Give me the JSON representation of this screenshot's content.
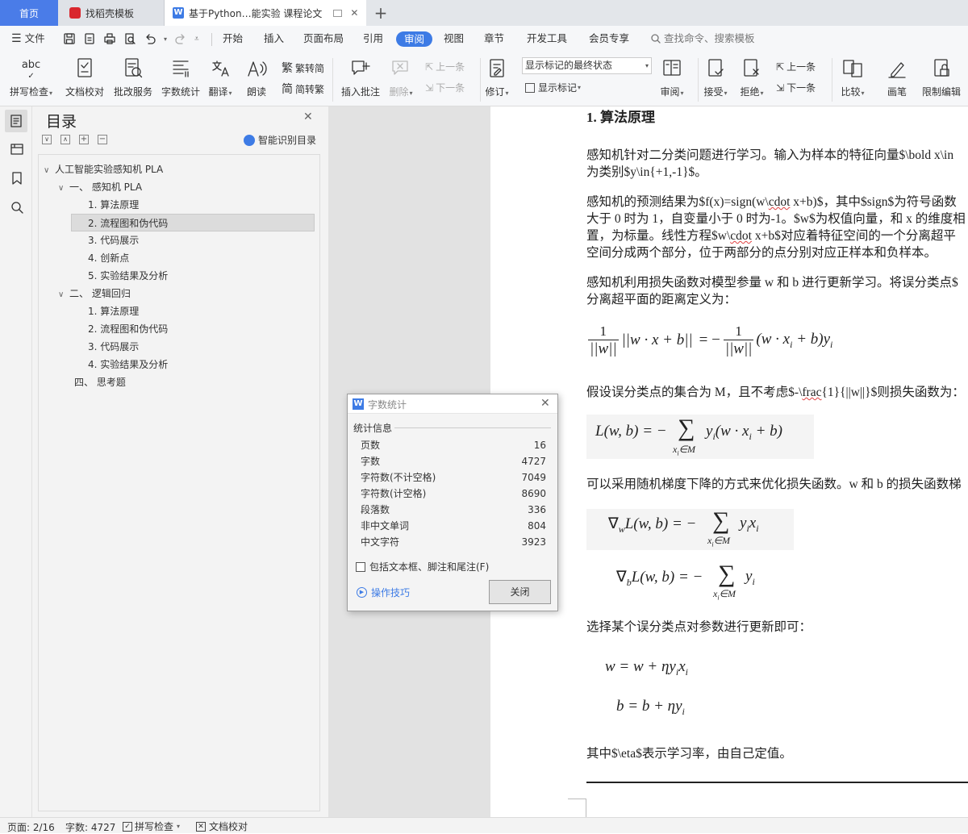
{
  "tabs": {
    "home": "首页",
    "template": "找稻壳模板",
    "doc": "基于Python…能实验 课程论文"
  },
  "menu": {
    "file": "文件",
    "items": [
      "开始",
      "插入",
      "页面布局",
      "引用",
      "审阅",
      "视图",
      "章节",
      "开发工具",
      "会员专享"
    ],
    "search": "查找命令、搜索模板"
  },
  "ribbon": {
    "spell": "拼写检查",
    "proof": "文档校对",
    "correct": "批改服务",
    "count": "字数统计",
    "translate": "翻译",
    "read": "朗读",
    "trad": "繁转简",
    "simp": "简转繁",
    "comment": "插入批注",
    "delete": "删除",
    "prev": "上一条",
    "next": "下一条",
    "revise": "修订",
    "markup_select": "显示标记的最终状态",
    "show_markup": "显示标记",
    "review": "审阅",
    "accept": "接受",
    "reject": "拒绝",
    "prev2": "上一条",
    "next2": "下一条",
    "compare": "比较",
    "pen": "画笔",
    "restrict": "限制编辑"
  },
  "toc": {
    "title": "目录",
    "smart": "智能识别目录",
    "items": [
      {
        "text": "人工智能实验感知机 PLA",
        "level": 0,
        "toggle": "∨"
      },
      {
        "text": "一、  感知机 PLA",
        "level": 1,
        "toggle": "∨"
      },
      {
        "text": "1. 算法原理",
        "level": 2
      },
      {
        "text": "2. 流程图和伪代码",
        "level": 2,
        "selected": true
      },
      {
        "text": "3. 代码展示",
        "level": 2
      },
      {
        "text": "4. 创新点",
        "level": 2
      },
      {
        "text": "5. 实验结果及分析",
        "level": 2
      },
      {
        "text": "二、  逻辑回归",
        "level": 1,
        "toggle": "∨"
      },
      {
        "text": "1. 算法原理",
        "level": 2
      },
      {
        "text": "2. 流程图和伪代码",
        "level": 2
      },
      {
        "text": "3. 代码展示",
        "level": 2
      },
      {
        "text": "4. 实验结果及分析",
        "level": 2
      },
      {
        "text": "四、  思考题",
        "level": 1
      }
    ]
  },
  "doc": {
    "heading": "1.  算法原理",
    "p1a": "感知机针对二分类问题进行学习。输入为样本的特征向量$\\bold x\\in",
    "p1b": "为类别$y\\in{+1,-1}$。",
    "p2a_pre": "感知机的预测结果为$f(x)=sign(w\\",
    "p2a_red": "cdot",
    "p2a_post": " x+b)$，其中$sign$为符号函数",
    "p2b": "大于 0 时为 1，自变量小于 0 时为-1。$w$为权值向量，和 x 的维度相",
    "p2c_pre": "置，为标量。线性方程$w\\",
    "p2c_red": "cdot",
    "p2c_post": " x+b$对应着特征空间的一个分离超平",
    "p2d": "空间分成两个部分，位于两部分的点分别对应正样本和负样本。",
    "p3a": "感知机利用损失函数对模型参量 w 和 b 进行更新学习。将误分类点$",
    "p3b": "分离超平面的距离定义为：",
    "p4_pre": "假设误分类点的集合为 M，且不考虑$-\\",
    "p4_red": "frac",
    "p4_post": "{1}{||w||}$则损失函数为：",
    "p5": "可以采用随机梯度下降的方式来优化损失函数。w 和 b 的损失函数梯",
    "p6": "选择某个误分类点对参数进行更新即可：",
    "p7": "其中$\\eta$表示学习率，由自己定值。"
  },
  "dialog": {
    "title": "字数统计",
    "section": "统计信息",
    "rows": [
      {
        "label": "页数",
        "value": "16"
      },
      {
        "label": "字数",
        "value": "4727"
      },
      {
        "label": "字符数(不计空格)",
        "value": "7049"
      },
      {
        "label": "字符数(计空格)",
        "value": "8690"
      },
      {
        "label": "段落数",
        "value": "336"
      },
      {
        "label": "非中文单词",
        "value": "804"
      },
      {
        "label": "中文字符",
        "value": "3923"
      }
    ],
    "include": "包括文本框、脚注和尾注(F)",
    "tips": "操作技巧",
    "close": "关闭"
  },
  "status": {
    "page": "页面: 2/16",
    "words": "字数: 4727",
    "spell": "拼写检查",
    "proof": "文档校对"
  }
}
